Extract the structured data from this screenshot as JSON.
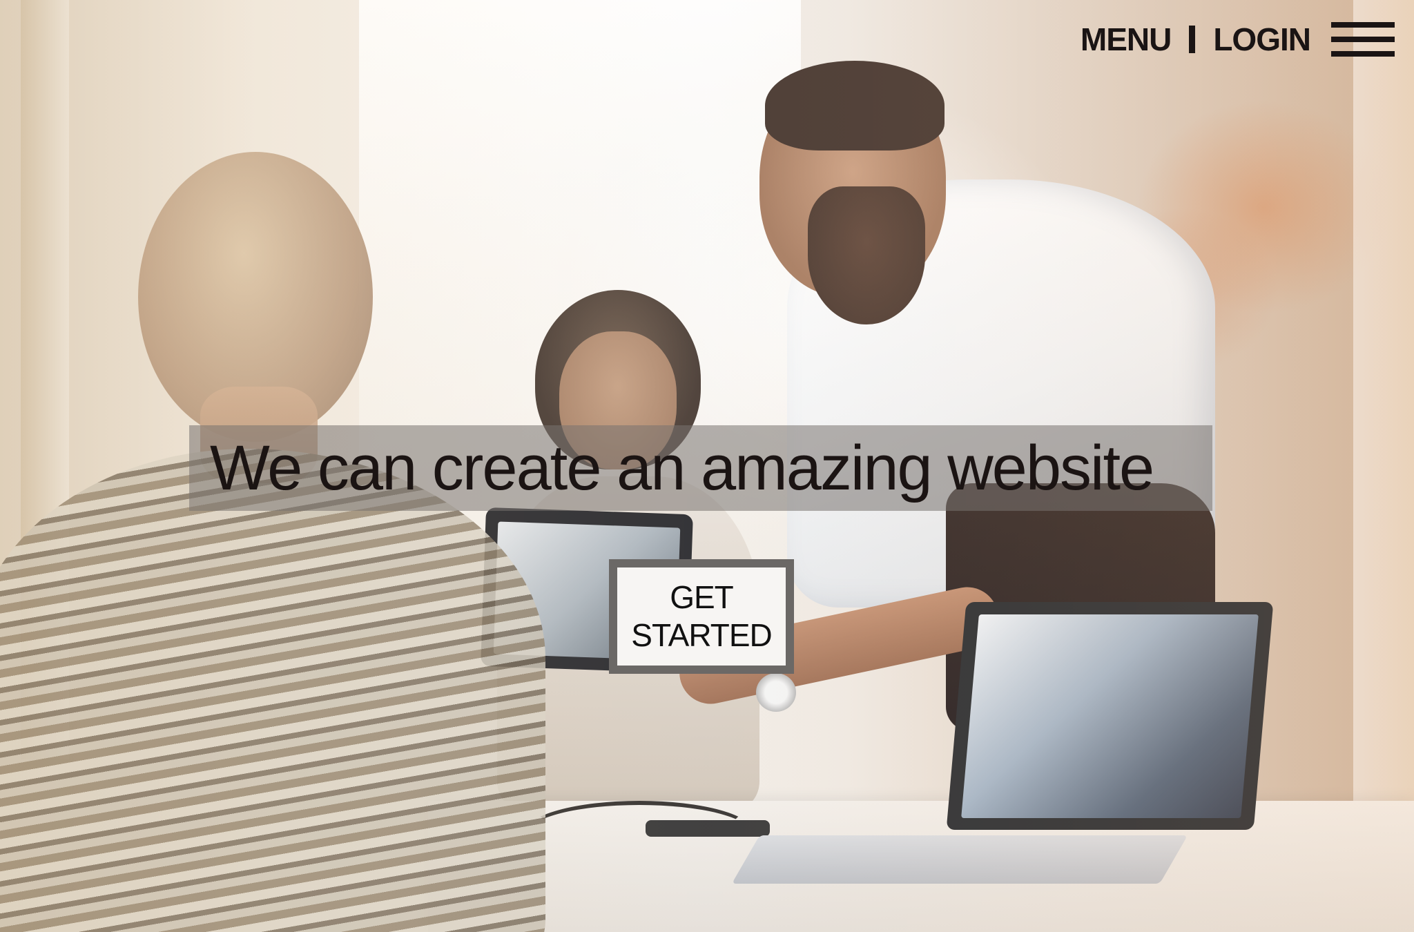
{
  "nav": {
    "menu_label": "MENU",
    "login_label": "LOGIN",
    "hamburger_icon": "hamburger-menu-icon"
  },
  "hero": {
    "headline": "We can create an amazing website",
    "cta_line1": "GET",
    "cta_line2": "STARTED"
  },
  "colors": {
    "text_dark": "#1a1414",
    "headline_band": "#78736f",
    "button_border": "#6b6866",
    "button_fill": "#f7f5f3"
  }
}
